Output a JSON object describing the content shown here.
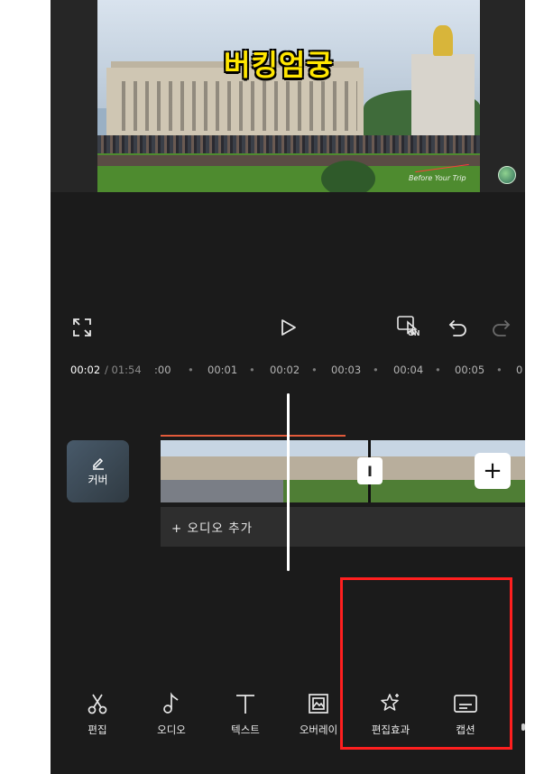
{
  "preview": {
    "caption": "버킹엄궁",
    "watermark": "Before Your Trip"
  },
  "playback": {
    "fullscreen_icon": "fullscreen-icon",
    "play_icon": "play-icon",
    "preview_toggle_label": "ON",
    "undo_icon": "undo-icon",
    "redo_icon": "redo-icon"
  },
  "timeline": {
    "current_time": "00:02",
    "total_time": "/ 01:54",
    "ticks": [
      ":00",
      "00:01",
      "00:02",
      "00:03",
      "00:04",
      "00:05",
      "0"
    ]
  },
  "cover": {
    "label": "커버"
  },
  "audio": {
    "add_label": "+ 오디오 추가"
  },
  "clip": {
    "split_label": "I",
    "add_label": "+"
  },
  "toolbar": {
    "items": [
      {
        "label": "편집",
        "icon": "scissors-icon"
      },
      {
        "label": "오디오",
        "icon": "music-note-icon"
      },
      {
        "label": "텍스트",
        "icon": "text-icon"
      },
      {
        "label": "오버레이",
        "icon": "overlay-icon"
      },
      {
        "label": "편집효과",
        "icon": "effects-star-icon"
      },
      {
        "label": "캡션",
        "icon": "caption-icon"
      }
    ]
  },
  "colors": {
    "background": "#1b1b1b",
    "caption_yellow": "#ffe600",
    "highlight_red": "#ff1f1f",
    "clip_marker": "#e25a3a"
  }
}
